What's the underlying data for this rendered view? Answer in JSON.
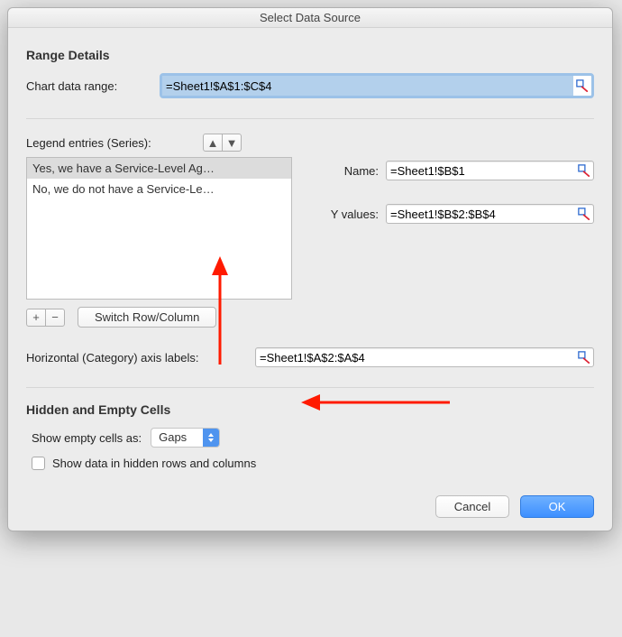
{
  "dialog": {
    "title": "Select Data Source",
    "range_details": {
      "heading": "Range Details",
      "chart_data_range_label": "Chart data range:",
      "chart_data_range_value": "=Sheet1!$A$1:$C$4"
    },
    "legend": {
      "label": "Legend entries (Series):",
      "series": [
        "Yes, we have a Service-Level Ag…",
        "No, we do not have a Service-Le…"
      ],
      "selected_index": 0,
      "switch_button": "Switch Row/Column"
    },
    "series_detail": {
      "name_label": "Name:",
      "name_value": "=Sheet1!$B$1",
      "yvalues_label": "Y values:",
      "yvalues_value": "=Sheet1!$B$2:$B$4"
    },
    "axis_labels": {
      "label": "Horizontal (Category) axis labels:",
      "value": "=Sheet1!$A$2:$A$4"
    },
    "hidden_empty": {
      "heading": "Hidden and Empty Cells",
      "show_empty_label": "Show empty cells as:",
      "show_empty_value": "Gaps",
      "show_hidden_label": "Show data in hidden rows and columns",
      "show_hidden_checked": false
    },
    "buttons": {
      "cancel": "Cancel",
      "ok": "OK"
    }
  }
}
